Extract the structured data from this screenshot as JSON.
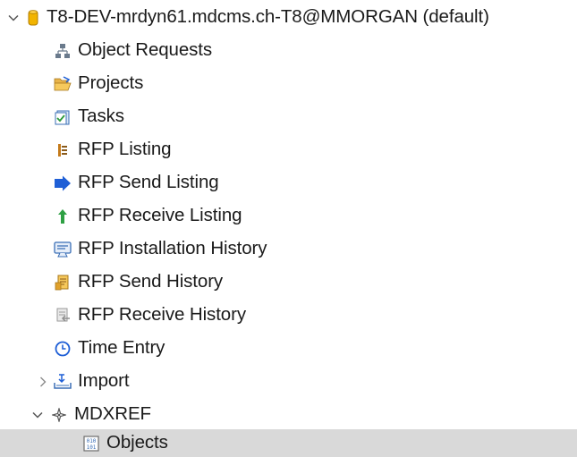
{
  "tree": {
    "root": {
      "label": "T8-DEV-mrdyn61.mdcms.ch-T8@MMORGAN (default)",
      "expanded": true,
      "icon": "database-icon"
    },
    "items": [
      {
        "label": "Object Requests",
        "icon": "hierarchy-icon"
      },
      {
        "label": "Projects",
        "icon": "folder-open-icon"
      },
      {
        "label": "Tasks",
        "icon": "task-list-icon"
      },
      {
        "label": "RFP Listing",
        "icon": "list-columns-icon"
      },
      {
        "label": "RFP Send Listing",
        "icon": "arrow-right-icon"
      },
      {
        "label": "RFP Receive Listing",
        "icon": "arrow-up-icon"
      },
      {
        "label": "RFP Installation History",
        "icon": "monitor-icon"
      },
      {
        "label": "RFP Send History",
        "icon": "history-send-icon"
      },
      {
        "label": "RFP Receive History",
        "icon": "history-receive-icon"
      },
      {
        "label": "Time Entry",
        "icon": "clock-icon"
      },
      {
        "label": "Import",
        "icon": "import-tray-icon",
        "expanded": false
      },
      {
        "label": "MDXREF",
        "icon": "mdxref-icon",
        "expanded": true
      },
      {
        "label": "Objects",
        "icon": "binary-grid-icon",
        "selected": true
      }
    ]
  },
  "colors": {
    "selection_bg": "#d9d9d9",
    "text": "#1a1a1a",
    "database": "#f0b400",
    "blue": "#1f5fd6",
    "green": "#2ea043",
    "orange": "#d88a00"
  }
}
